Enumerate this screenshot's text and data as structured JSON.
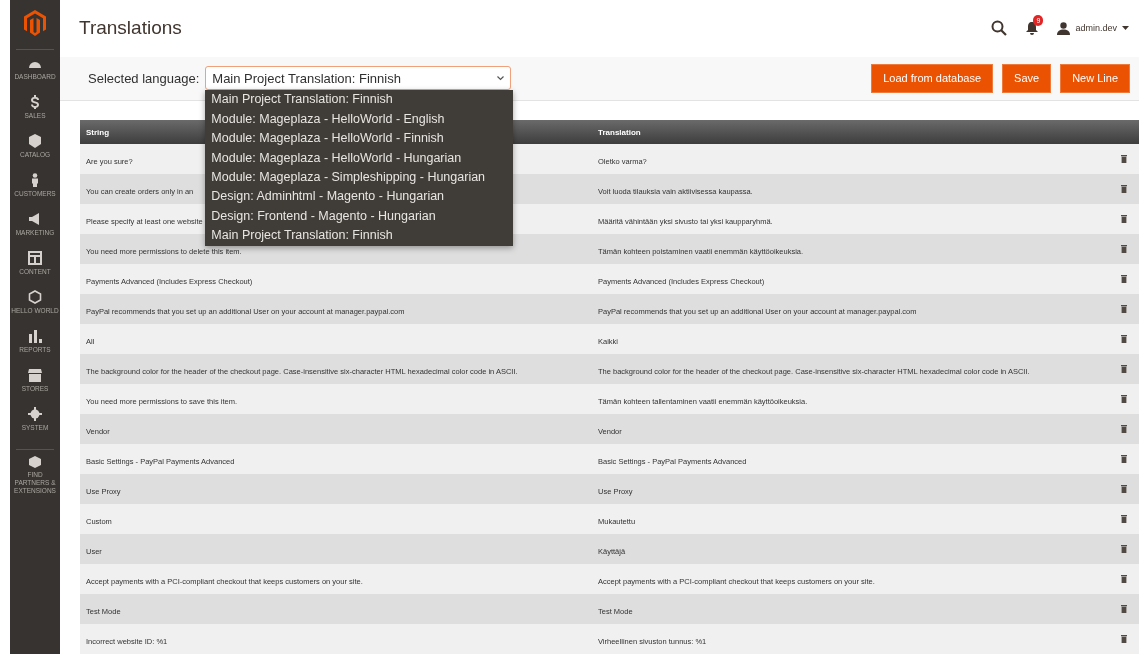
{
  "page_title": "Translations",
  "header": {
    "notification_count": "9",
    "user": "admin.dev"
  },
  "sidebar": {
    "items": [
      {
        "kind": "dashboard",
        "label": "DASHBOARD"
      },
      {
        "kind": "sales",
        "label": "SALES"
      },
      {
        "kind": "catalog",
        "label": "CATALOG"
      },
      {
        "kind": "customers",
        "label": "CUSTOMERS"
      },
      {
        "kind": "marketing",
        "label": "MARKETING"
      },
      {
        "kind": "content",
        "label": "CONTENT"
      },
      {
        "kind": "hexagon",
        "label": "HELLO WORLD"
      },
      {
        "kind": "reports",
        "label": "REPORTS"
      },
      {
        "kind": "stores",
        "label": "STORES"
      },
      {
        "kind": "system",
        "label": "SYSTEM"
      },
      {
        "kind": "partners",
        "label": "FIND PARTNERS & EXTENSIONS"
      }
    ]
  },
  "toolbar": {
    "language_label": "Selected language:",
    "language_value": "Main Project Translation: Finnish",
    "buttons": [
      "Load from database",
      "Save",
      "New Line"
    ]
  },
  "dropdown": {
    "expanded": true,
    "options": [
      {
        "label": "Main Project Translation: Finnish",
        "selected": false
      },
      {
        "label": "Module: Mageplaza - HelloWorld - English",
        "selected": false
      },
      {
        "label": "Module: Mageplaza - HelloWorld - Finnish",
        "selected": false
      },
      {
        "label": "Module: Mageplaza - HelloWorld - Hungarian",
        "selected": false
      },
      {
        "label": "Module: Mageplaza - Simpleshipping - Hungarian",
        "selected": false
      },
      {
        "label": "Design: Adminhtml - Magento - Hungarian",
        "selected": false
      },
      {
        "label": "Design: Frontend - Magento - Hungarian",
        "selected": false
      },
      {
        "label": "Main Project Translation: Finnish",
        "selected": false
      }
    ]
  },
  "table": {
    "columns": [
      "String",
      "Translation"
    ],
    "rows": [
      {
        "string": "Are you sure?",
        "translation": "Oletko varma?"
      },
      {
        "string": "You can create orders only in an",
        "translation": "Voit luoda tilauksia vain aktiivisessa kaupassa."
      },
      {
        "string": "Please specify at least one website",
        "translation": "Määritä vähintään yksi sivusto tai yksi kaupparyhmä."
      },
      {
        "string": "You need more permissions to delete this item.",
        "translation": "Tämän kohteen poistaminen vaatii enemmän käyttöoikeuksia."
      },
      {
        "string": "Payments Advanced (Includes Express Checkout)",
        "translation": "Payments Advanced (Includes Express Checkout)"
      },
      {
        "string": "PayPal recommends that you set up an additional User on your account at manager.paypal.com",
        "translation": "PayPal recommends that you set up an additional User on your account at manager.paypal.com"
      },
      {
        "string": "All",
        "translation": "Kaikki"
      },
      {
        "string": "The background color for the header of the checkout page. Case-insensitive six-character HTML hexadecimal color code in ASCII.",
        "translation": "The background color for the header of the checkout page. Case-insensitive six-character HTML hexadecimal color code in ASCII."
      },
      {
        "string": "You need more permissions to save this item.",
        "translation": "Tämän kohteen tallentaminen vaatii enemmän käyttöoikeuksia."
      },
      {
        "string": "Vendor",
        "translation": "Vendor"
      },
      {
        "string": "Basic Settings - PayPal Payments Advanced",
        "translation": "Basic Settings - PayPal Payments Advanced"
      },
      {
        "string": "Use Proxy",
        "translation": "Use Proxy"
      },
      {
        "string": "Custom",
        "translation": "Mukautettu"
      },
      {
        "string": "User",
        "translation": "Käyttäjä"
      },
      {
        "string": "Accept payments with a PCI-compliant checkout that keeps customers on your site.",
        "translation": "Accept payments with a PCI-compliant checkout that keeps customers on your site."
      },
      {
        "string": "Test Mode",
        "translation": "Test Mode"
      },
      {
        "string": "Incorrect website ID: %1",
        "translation": "Virheellinen sivuston tunnus: %1"
      }
    ]
  }
}
